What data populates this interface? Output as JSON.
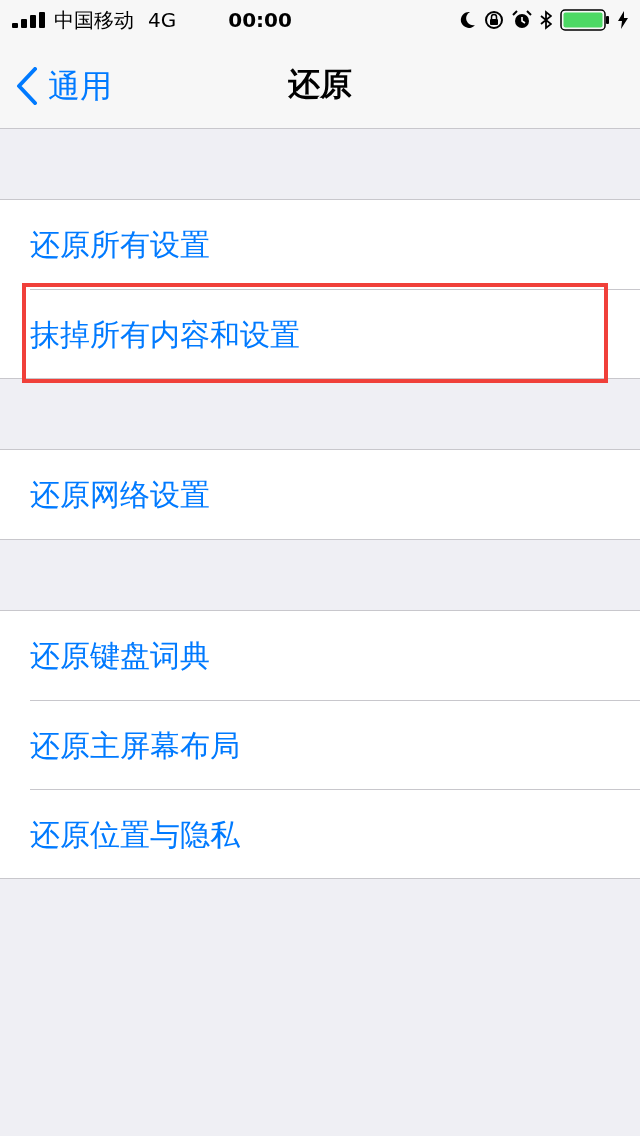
{
  "status_bar": {
    "carrier": "中国移动",
    "network": "4G",
    "time": "00:00"
  },
  "nav": {
    "back": "通用",
    "title": "还原"
  },
  "groups": [
    {
      "items": [
        {
          "label": "还原所有设置",
          "highlighted": false
        },
        {
          "label": "抹掉所有内容和设置",
          "highlighted": true
        }
      ]
    },
    {
      "items": [
        {
          "label": "还原网络设置",
          "highlighted": false
        }
      ]
    },
    {
      "items": [
        {
          "label": "还原键盘词典",
          "highlighted": false
        },
        {
          "label": "还原主屏幕布局",
          "highlighted": false
        },
        {
          "label": "还原位置与隐私",
          "highlighted": false
        }
      ]
    }
  ]
}
